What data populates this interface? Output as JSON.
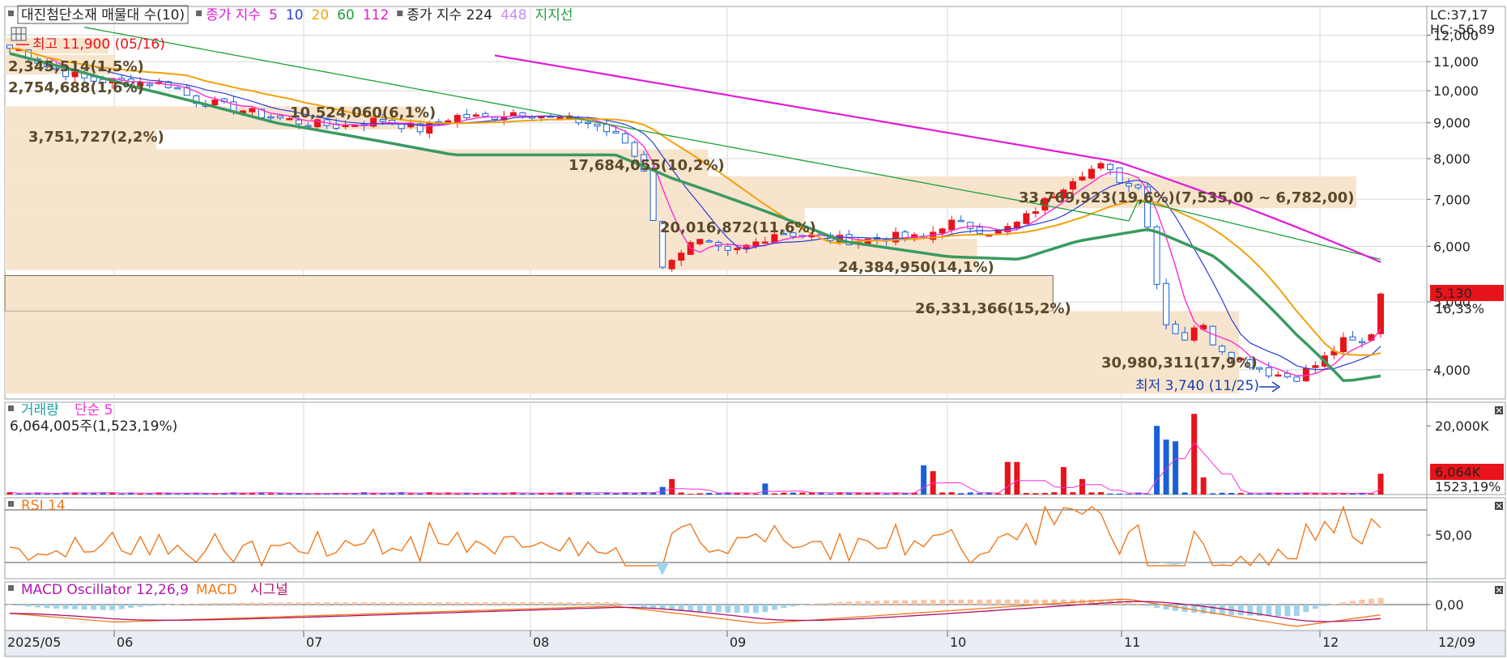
{
  "colors": {
    "up": "#e8141b",
    "down": "#1a5fd6",
    "ma5": "#ff2bd3",
    "ma10": "#2a3cd9",
    "ma20": "#f0a20a",
    "ma60": "#1fa13a",
    "ma112": "#e11ad8",
    "support": "#3a9a60",
    "vp_bar": "#f7e4cd",
    "vp_border": "#7a6a5a",
    "rsi": "#f07a1e",
    "macd_osc_pos": "#f6c6a8",
    "macd_osc_neg": "#9fd3ea",
    "macd": "#f07a1e",
    "signal": "#b0106a",
    "price_tag_bg": "#e8141b"
  },
  "price_panel": {
    "legend": [
      {
        "text": "대진첨단소재 매물대 수(10)",
        "color": "#222222",
        "boxed": true
      },
      {
        "text": "종가 지수",
        "color": "#e11ad8"
      },
      {
        "text": "5",
        "color": "#e11ad8"
      },
      {
        "text": "10",
        "color": "#2a3cd9"
      },
      {
        "text": "20",
        "color": "#f0a20a"
      },
      {
        "text": "60",
        "color": "#1fa13a"
      },
      {
        "text": "112",
        "color": "#e11ad8"
      },
      {
        "text": "종가 지수 224",
        "color": "#222222"
      },
      {
        "text": "448",
        "color": "#c38ef0"
      },
      {
        "text": "지지선",
        "color": "#1fa13a"
      }
    ],
    "lc_label": "LC:37,17",
    "hc_label": "HC:-56,89",
    "high_annotation": "최고 11,900 (05/16)",
    "low_annotation": "최저 3,740 (11/25)",
    "current_price_tag": "5,130",
    "current_change": "16,33%",
    "y_ticks": [
      "12,000",
      "11,000",
      "10,000",
      "9,000",
      "8,000",
      "7,000",
      "6,000",
      "5,000",
      "4,000"
    ],
    "volume_profile": [
      {
        "label": "2,345,514(1,5%)"
      },
      {
        "label": "2,754,688(1,6%)"
      },
      {
        "label": "3,751,727(2,2%)"
      },
      {
        "label": "10,524,060(6,1%)"
      },
      {
        "label": "17,684,055(10,2%)"
      },
      {
        "label": "33,769,923(19,6%)(7,535,00 ~ 6,782,00)"
      },
      {
        "label": "20,016,872(11,6%)"
      },
      {
        "label": "24,384,950(14,1%)"
      },
      {
        "label": "26,331,366(15,2%)"
      },
      {
        "label": "30,980,311(17,9%)"
      }
    ]
  },
  "volume_panel": {
    "legend_title": "거래량",
    "legend_ma": "단순 5",
    "last_value_text": "6,064,005주(1,523,19%)",
    "y_tick": "20,000K",
    "tag_value": "6,064K",
    "tag_change": "1523,19%"
  },
  "rsi_panel": {
    "legend": "RSI 14",
    "y_tick": "50,00"
  },
  "macd_panel": {
    "legend_osc": "MACD Oscillator 12,26,9",
    "legend_macd": "MACD",
    "legend_signal": "시그널",
    "y_tick": "0,00"
  },
  "x_axis": {
    "labels": [
      "2025/05",
      "06",
      "07",
      "08",
      "09",
      "10",
      "11",
      "12",
      "12/09"
    ]
  },
  "chart_data": {
    "type": "candlestick",
    "title": "대진첨단소재 매물대 수(10)",
    "period": "2025/05 ~ 12/09 (daily)",
    "ylim": [
      3500,
      12300
    ],
    "y_scale": "log",
    "monthly_closes": [
      {
        "month": "2025/05",
        "close": 10300
      },
      {
        "month": "06",
        "close": 9000
      },
      {
        "month": "07",
        "close": 9150
      },
      {
        "month": "08",
        "close": 6300
      },
      {
        "month": "09",
        "close": 6500
      },
      {
        "month": "10",
        "close": 7600
      },
      {
        "month": "11",
        "close": 3800
      },
      {
        "month": "12",
        "close": 5130
      }
    ],
    "high": {
      "value": 11900,
      "date": "05/16"
    },
    "low": {
      "value": 3740,
      "date": "11/25"
    },
    "last_close": 5130,
    "last_change_pct": 16.33,
    "volume_profile": [
      {
        "volume": 2345514,
        "pct": 1.5
      },
      {
        "volume": 2754688,
        "pct": 1.6
      },
      {
        "volume": 3751727,
        "pct": 2.2
      },
      {
        "volume": 10524060,
        "pct": 6.1
      },
      {
        "volume": 17684055,
        "pct": 10.2
      },
      {
        "volume": 33769923,
        "pct": 19.6,
        "range": [
          6782,
          7535
        ]
      },
      {
        "volume": 20016872,
        "pct": 11.6
      },
      {
        "volume": 24384950,
        "pct": 14.1
      },
      {
        "volume": 26331366,
        "pct": 15.2
      },
      {
        "volume": 30980311,
        "pct": 17.9
      }
    ],
    "last_volume": 6064005,
    "last_volume_change_pct": 1523.19,
    "rsi_period": 14,
    "macd_params": [
      12,
      26,
      9
    ]
  }
}
